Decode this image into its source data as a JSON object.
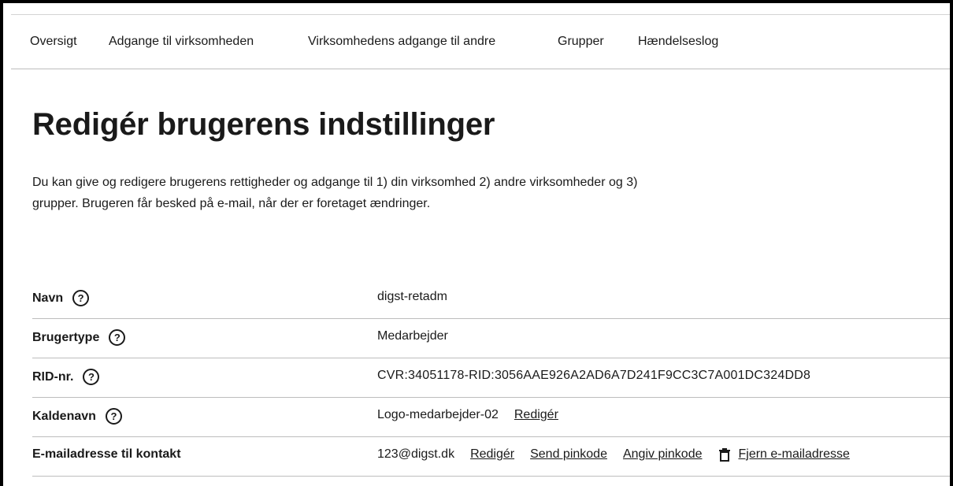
{
  "nav": {
    "items": [
      {
        "label": "Oversigt"
      },
      {
        "label": "Adgange til virksomheden"
      },
      {
        "label": "Virksomhedens adgange til andre"
      },
      {
        "label": "Grupper"
      },
      {
        "label": "Hændelseslog"
      }
    ]
  },
  "page": {
    "title": "Redigér brugerens indstillinger",
    "intro": "Du kan give og redigere brugerens rettigheder og adgange til 1) din virksomhed 2) andre virksomheder og 3) grupper. Brugeren får besked på e-mail, når der er foretaget ændringer."
  },
  "help_glyph": "?",
  "fields": [
    {
      "label": "Navn",
      "value": "digst-retadm"
    },
    {
      "label": "Brugertype",
      "value": "Medarbejder"
    },
    {
      "label": "RID-nr.",
      "value": "CVR:34051178-RID:3056AAE926A2AD6A7D241F9CC3C7A001DC324DD8"
    },
    {
      "label": "Kaldenavn",
      "value": "Logo-medarbejder-02",
      "edit_label": "Redigér"
    },
    {
      "label": "E-mailadresse til kontakt",
      "value": "123@digst.dk",
      "edit_label": "Redigér",
      "send_pin_label": "Send pinkode",
      "set_pin_label": "Angiv pinkode",
      "remove_label": "Fjern e-mailadresse"
    }
  ],
  "icons": {
    "help": "help-circle-icon",
    "remove": "trash-icon"
  }
}
